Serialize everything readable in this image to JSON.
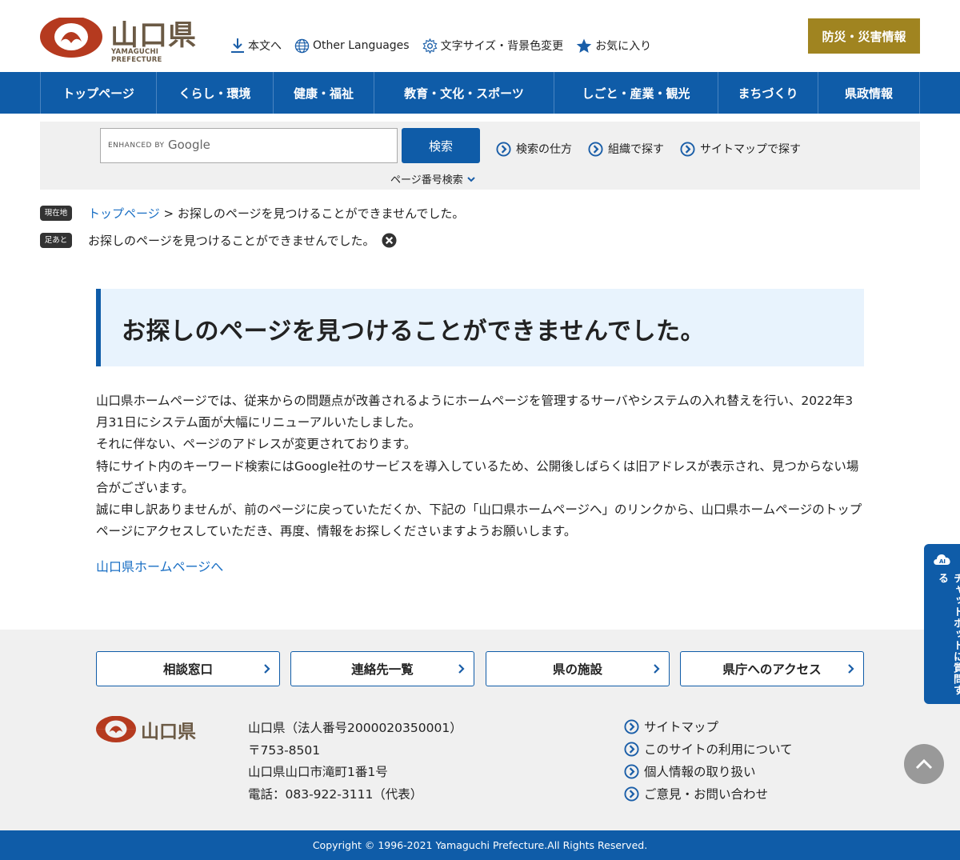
{
  "header": {
    "logo_kanji": "山口県",
    "logo_romaji": "YAMAGUCHI PREFECTURE",
    "util": {
      "skip": "本文へ",
      "languages": "Other Languages",
      "textsize": "文字サイズ・背景色変更",
      "favorite": "お気に入り"
    },
    "disaster": "防災・災害情報"
  },
  "nav": [
    "トップページ",
    "くらし・環境",
    "健康・福祉",
    "教育・文化・スポーツ",
    "しごと・産業・観光",
    "まちづくり",
    "県政情報"
  ],
  "search": {
    "enhanced": "ENHANCED BY",
    "google": "Google",
    "button": "検索",
    "links": [
      "検索の仕方",
      "組織で探す",
      "サイトマップで探す"
    ],
    "page_number": "ページ番号検索"
  },
  "breadcrumb": {
    "tag": "現在地",
    "home": "トップページ",
    "separator": " > ",
    "current": "お探しのページを見つけることができませんでした。"
  },
  "footprint": {
    "tag": "足あと",
    "item": "お探しのページを見つけることができませんでした。"
  },
  "main": {
    "title": "お探しのページを見つけることができませんでした。",
    "paragraphs": [
      "山口県ホームページでは、従来からの問題点が改善されるようにホームページを管理するサーバやシステムの入れ替えを行い、2022年3月31日にシステム面が大幅にリニューアルいたしました。",
      "それに伴ない、ページのアドレスが変更されております。",
      "特にサイト内のキーワード検索にはGoogle社のサービスを導入しているため、公開後しばらくは旧アドレスが表示され、見つからない場合がございます。",
      "誠に申し訳ありませんが、前のページに戻っていただくか、下記の「山口県ホームページへ」のリンクから、山口県ホームページのトップページにアクセスしていただき、再度、情報をお探しくださいますようお願いします。"
    ],
    "home_link": "山口県ホームページへ"
  },
  "footer": {
    "buttons": [
      "相談窓口",
      "連絡先一覧",
      "県の施設",
      "県庁へのアクセス"
    ],
    "logo_kanji": "山口県",
    "address": [
      "山口県（法人番号2000020350001）",
      "〒753-8501",
      "山口県山口市滝町1番1号",
      "電話：083-922-3111（代表）"
    ],
    "links": [
      "サイトマップ",
      "このサイトの利用について",
      "個人情報の取り扱い",
      "ご意見・お問い合わせ"
    ],
    "copyright": "Copyright © 1996-2021 Yamaguchi Prefecture.All Rights Reserved."
  },
  "chatbot": {
    "ai_label": "AI",
    "label": "チャットボットに質問する"
  },
  "colors": {
    "primary": "#0f5ca8",
    "disaster": "#a08420",
    "logo_red": "#b53a1f",
    "logo_brown": "#6b5a45",
    "title_bg": "#e8f3fd"
  }
}
